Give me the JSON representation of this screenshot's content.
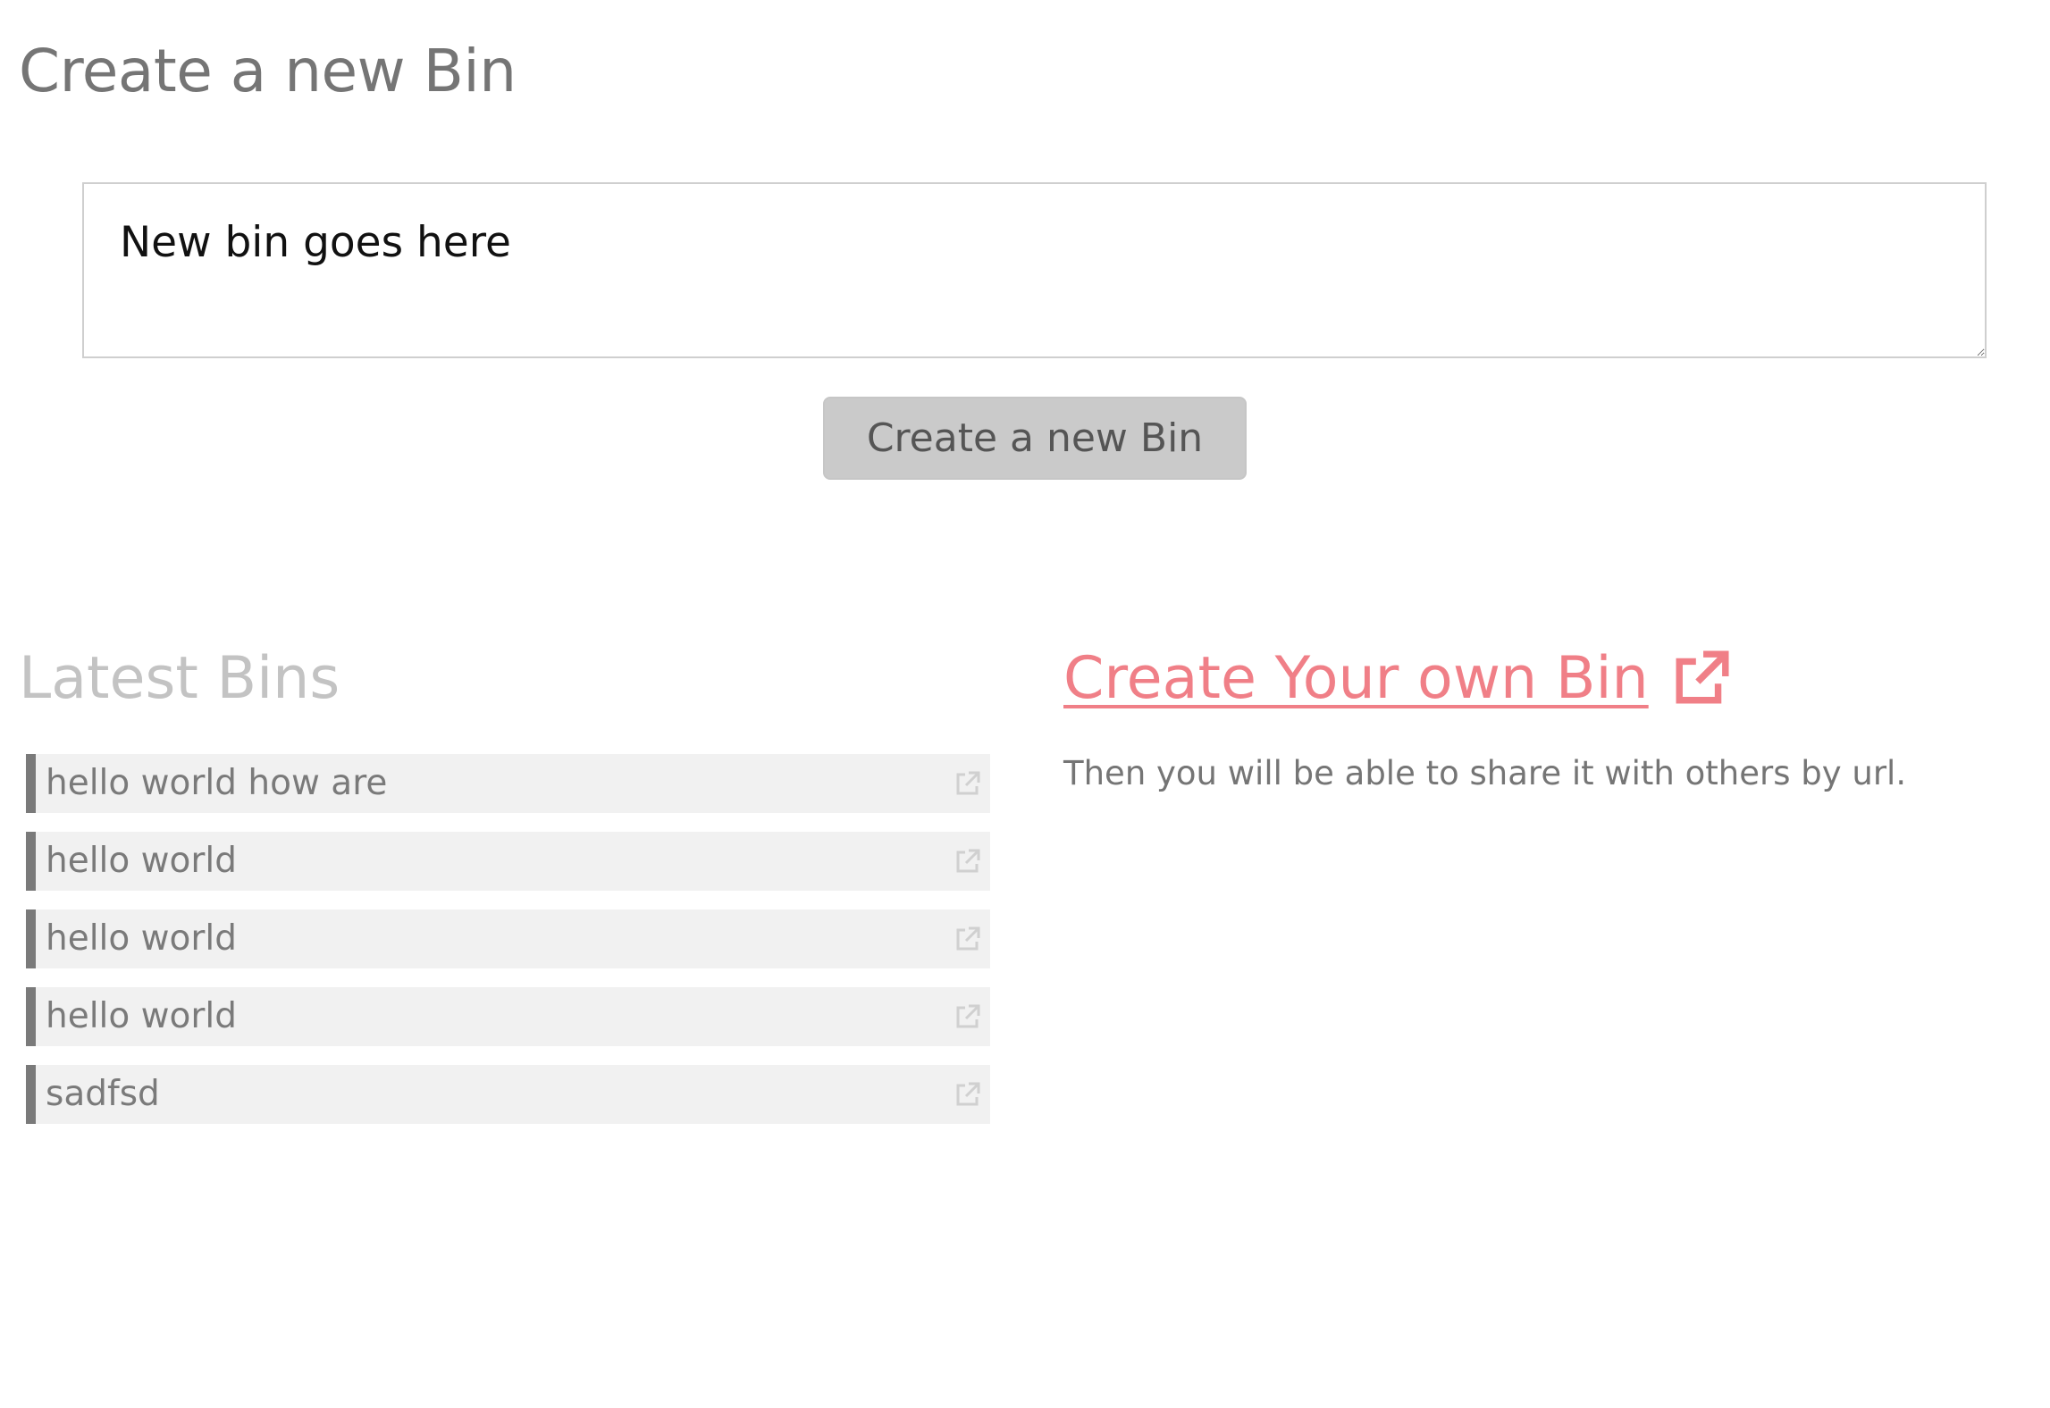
{
  "header": {
    "title": "Create a new Bin"
  },
  "editor": {
    "placeholder": "New bin goes here",
    "value": ""
  },
  "actions": {
    "create_label": "Create a new Bin"
  },
  "latest": {
    "title": "Latest Bins",
    "items": [
      {
        "label": "hello world how are",
        "icon": "external-link-icon"
      },
      {
        "label": "hello world",
        "icon": "external-link-icon"
      },
      {
        "label": "hello world",
        "icon": "external-link-icon"
      },
      {
        "label": "hello world",
        "icon": "external-link-icon"
      },
      {
        "label": "sadfsd",
        "icon": "external-link-icon"
      }
    ]
  },
  "promo": {
    "link_label": "Create Your own Bin",
    "icon": "external-link-icon",
    "description": "Then you will be able to share it with others by url."
  },
  "colors": {
    "title": "#757575",
    "accent_link": "#f07f87",
    "latest_title": "#c3c3c3",
    "item_background": "#f1f1f1",
    "item_border": "#7a7a7a",
    "button_background": "#cacaca"
  }
}
